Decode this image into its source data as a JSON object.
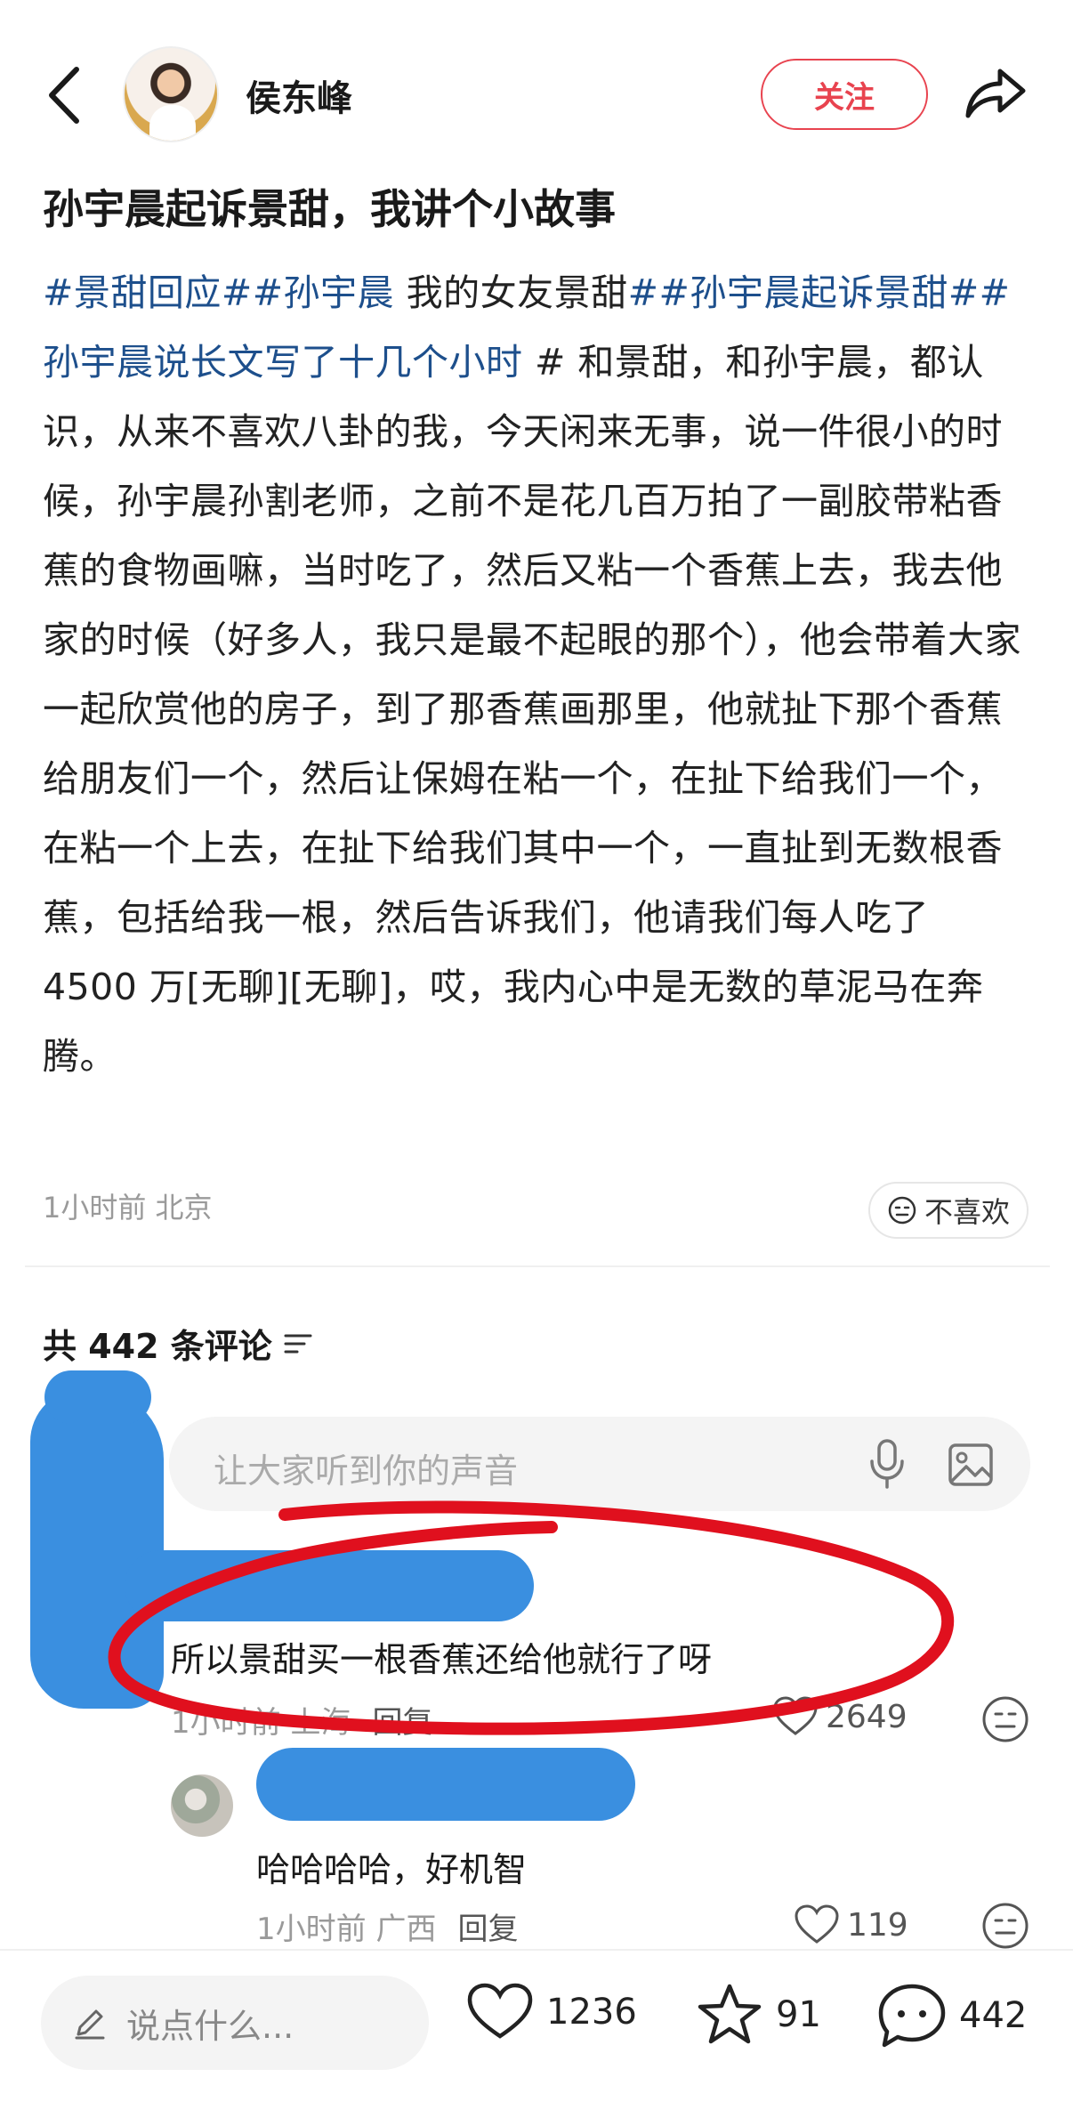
{
  "header": {
    "author_name": "侯东峰",
    "follow_label": "关注"
  },
  "post": {
    "title": "孙宇晨起诉景甜，我讲个小故事",
    "tag1": "#景甜回应##孙宇晨",
    "text1": " 我的女友景甜",
    "tag2": "##孙宇晨起诉景甜##孙宇晨说长文写了十几个小时",
    "text2": " # 和景甜，和孙宇晨，都认识，从来不喜欢八卦的我，今天闲来无事，说一件很小的时候，孙宇晨孙割老师，之前不是花几百万拍了一副胶带粘香蕉的食物画嘛，当时吃了，然后又粘一个香蕉上去，我去他家的时候（好多人，我只是最不起眼的那个），他会带着大家一起欣赏他的房子，到了那香蕉画那里，他就扯下那个香蕉给朋友们一个，然后让保姆在粘一个，在扯下给我们一个，在粘一个上去，在扯下给我们其中一个，一直扯到无数根香蕉，包括给我一根，然后告诉我们，他请我们每人吃了 4500 万[无聊][无聊]，哎，我内心中是无数的草泥马在奔腾。",
    "meta": "1小时前 北京",
    "dislike_label": "不喜欢"
  },
  "comments": {
    "count_label": "共 442 条评论",
    "input_placeholder": "让大家听到你的声音",
    "items": [
      {
        "text": "所以景甜买一根香蕉还给他就行了呀",
        "time_loc": "1小时前 上海",
        "reply": "回复",
        "likes": "2649"
      },
      {
        "text": "哈哈哈哈，好机智",
        "time_loc": "1小时前 广西",
        "reply": "回复",
        "likes": "119"
      }
    ]
  },
  "bottom_bar": {
    "input_placeholder": "说点什么...",
    "likes": "1236",
    "favorites": "91",
    "comments": "442"
  },
  "colors": {
    "accent": "#e8434f",
    "hashtag": "#1d4f8c",
    "redaction": "#3a8fe0",
    "annotation": "#e0101e"
  }
}
